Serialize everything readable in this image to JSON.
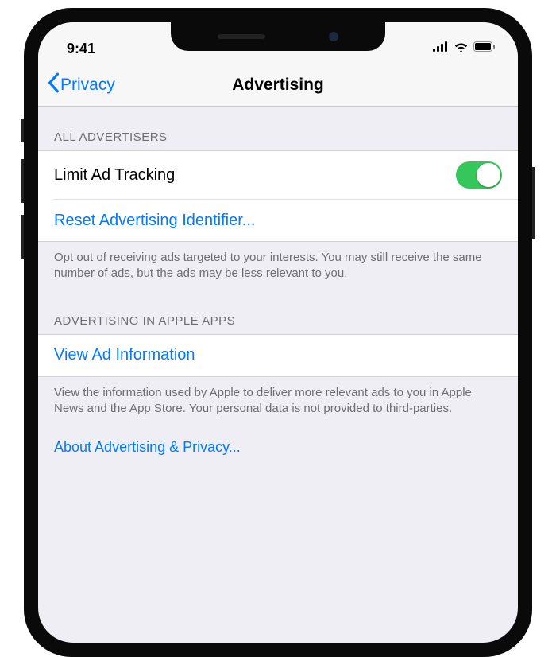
{
  "status": {
    "time": "9:41"
  },
  "nav": {
    "back": "Privacy",
    "title": "Advertising"
  },
  "section1": {
    "header": "ALL ADVERTISERS",
    "limit_label": "Limit Ad Tracking",
    "reset_label": "Reset Advertising Identifier...",
    "footer": "Opt out of receiving ads targeted to your interests. You may still receive the same number of ads, but the ads may be less relevant to you.",
    "toggle_on": true
  },
  "section2": {
    "header": "ADVERTISING IN APPLE APPS",
    "view_label": "View Ad Information",
    "footer": "View the information used by Apple to deliver more relevant ads to you in Apple News and the App Store. Your personal data is not provided to third-parties."
  },
  "about_link": "About Advertising & Privacy..."
}
